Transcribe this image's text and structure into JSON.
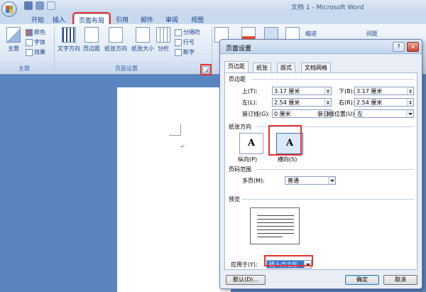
{
  "window": {
    "title": "文档 1 - Microsoft Word"
  },
  "tabs": [
    "开始",
    "插入",
    "页面布局",
    "引用",
    "邮件",
    "审阅",
    "视图"
  ],
  "ribbon": {
    "theme_button": "主题",
    "colors": "颜色",
    "fonts": "字体",
    "effects": "效果",
    "theme_group": "主题",
    "text_direction": "文字方向",
    "margins": "页边距",
    "orientation": "纸张方向",
    "size": "纸张大小",
    "columns": "分栏",
    "breaks": "分隔符",
    "line_numbers": "行号",
    "hyphenation": "断字",
    "page_setup_group": "页面设置",
    "indent_label": "缩进",
    "spacing_label": "间距"
  },
  "document": {
    "para_mark": "↵"
  },
  "dialog": {
    "title": "页面设置",
    "help": "?",
    "close": "x",
    "tabs": [
      "页边距",
      "纸张",
      "版式",
      "文档网格"
    ],
    "margins_section": "页边距",
    "top_label": "上(T):",
    "top_value": "3.17 厘米",
    "bottom_label": "下(B):",
    "bottom_value": "3.17 厘米",
    "left_label": "左(L):",
    "left_value": "2.54 厘米",
    "right_label": "右(R):",
    "right_value": "2.54 厘米",
    "gutter_label": "装订线(G):",
    "gutter_value": "0 厘米",
    "gutter_pos_label": "装订线位置(U):",
    "gutter_pos_value": "左",
    "orientation_section": "纸张方向",
    "portrait": "纵向(P)",
    "landscape": "横向(S)",
    "pages_section": "页码范围",
    "multiple_pages_label": "多页(M):",
    "multiple_pages_value": "普通",
    "preview_section": "预览",
    "apply_label": "应用于(Y):",
    "apply_value": "插入点之后",
    "default_button": "默认(D)...",
    "ok_button": "确定",
    "cancel_button": "取消"
  }
}
